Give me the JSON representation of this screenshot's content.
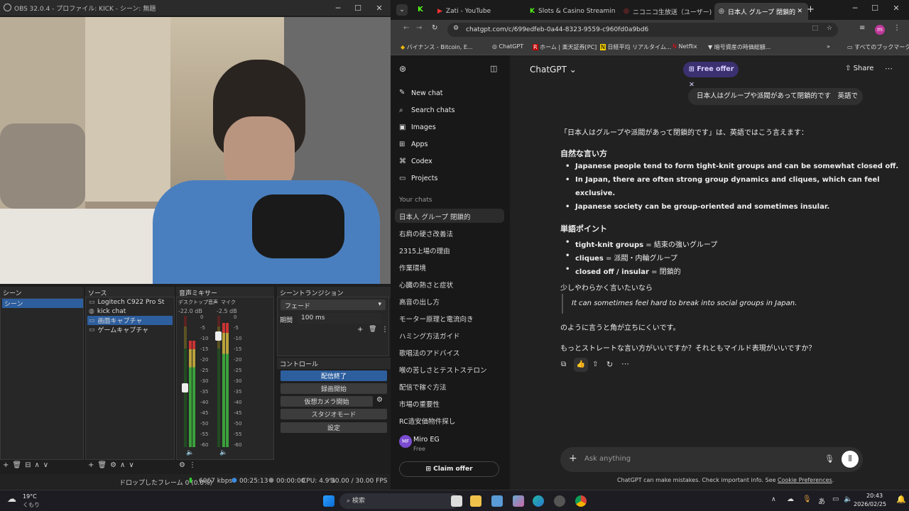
{
  "obs": {
    "title": "OBS 32.0.4 - プロファイル: KICK - シーン: 無題",
    "scenes_title": "シーン",
    "scene_items": [
      "シーン"
    ],
    "sources_title": "ソース",
    "sources": [
      "Logitech C922 Pro St",
      "kick chat",
      "画面キャプチャ",
      "ゲームキャプチャ"
    ],
    "mixer_title": "音声ミキサー",
    "mixer": [
      {
        "name": "デスクトップ音声",
        "db": "-22.0 dB"
      },
      {
        "name": "マイク",
        "db": "-2.5 dB"
      }
    ],
    "meter_ticks": [
      "0",
      "-5",
      "-10",
      "-15",
      "-20",
      "-25",
      "-30",
      "-35",
      "-40",
      "-45",
      "-50",
      "-55",
      "-60"
    ],
    "transition_title": "シーントランジション",
    "transition": "フェード",
    "duration_label": "期間",
    "duration": "100 ms",
    "controls_title": "コントロール",
    "controls": [
      "配信終了",
      "録画開始",
      "仮想カメラ開始",
      "スタジオモード",
      "設定"
    ],
    "status": {
      "dropped": "ドロップしたフレーム 0 (0.0%)",
      "kbps": "6067 kbps",
      "stream_time": "00:25:13",
      "rec_time": "00:00:00",
      "cpu": "CPU: 4.9%",
      "fps": "30.00 / 30.00 FPS"
    }
  },
  "browser": {
    "tabs": [
      "Zati - YouTube",
      "Slots & Casino Streamin",
      "ニコニコ生放送（ユーザー)",
      "日本人 グループ 閉鎖的"
    ],
    "url": "chatgpt.com/c/699edfeb-0a44-8323-9559-c960fd0a9bd6",
    "bookmarks": [
      "バイナンス - Bitcoin, E...",
      "ChatGPT",
      "ホーム | 楽天証券[PC]",
      "日経平均 リアルタイム...",
      "Netflix",
      "暗号資産の時価総額...",
      "すべてのブックマーク"
    ]
  },
  "sidebar": {
    "items": [
      "New chat",
      "Search chats",
      "Images",
      "Apps",
      "Codex",
      "Projects"
    ],
    "chats_label": "Your chats",
    "chats": [
      "日本人 グループ 閉鎖的",
      "右肩の硬さ改善法",
      "2315上場の理由",
      "作業環境",
      "心臓の熱さと症状",
      "高音の出し方",
      "モーター原理と電流向き",
      "ハミング方法ガイド",
      "歌唱法のアドバイス",
      "喉の苦しさとテストステロン",
      "配信で稼ぐ方法",
      "市場の重要性",
      "RC造安価物件探し"
    ],
    "user_name": "Miro EG",
    "user_plan": "Free",
    "user_initials": "MF",
    "claim": "Claim offer"
  },
  "chat": {
    "model": "ChatGPT",
    "offer": "Free offer",
    "share": "Share",
    "user_msg": "日本人はグループや派閥があって閉鎖的です　英語で",
    "intro": "「日本人はグループや派閥があって閉鎖的です」は、英語ではこう言えます：",
    "h1": "自然な言い方",
    "bullets1": [
      "Japanese people tend to form tight-knit groups and can be somewhat closed off.",
      "In Japan, there are often strong group dynamics and cliques, which can feel",
      "exclusive.",
      "Japanese society can be group-oriented and sometimes insular."
    ],
    "h2": "単語ポイント",
    "terms": [
      {
        "en": "tight-knit groups",
        "ja": " = 結束の強いグループ"
      },
      {
        "en": "cliques",
        "ja": " = 派閥・内輪グループ"
      },
      {
        "en": "closed off / insular",
        "ja": " = 閉鎖的"
      }
    ],
    "soft": "少しやわらかく言いたいなら",
    "quote": "It can sometimes feel hard to break into social groups in Japan.",
    "after": "のように言うと角が立ちにくいです。",
    "question": "もっとストレートな言い方がいいですか？それともマイルド表現がいいですか？",
    "placeholder": "Ask anything",
    "footer": "ChatGPT can make mistakes. Check important info. See ",
    "footer_link": "Cookie Preferences",
    "footer_end": "."
  },
  "taskbar": {
    "temp": "19°C",
    "weather": "くもり",
    "search": "検索",
    "time": "20:43",
    "date": "2026/02/25"
  }
}
